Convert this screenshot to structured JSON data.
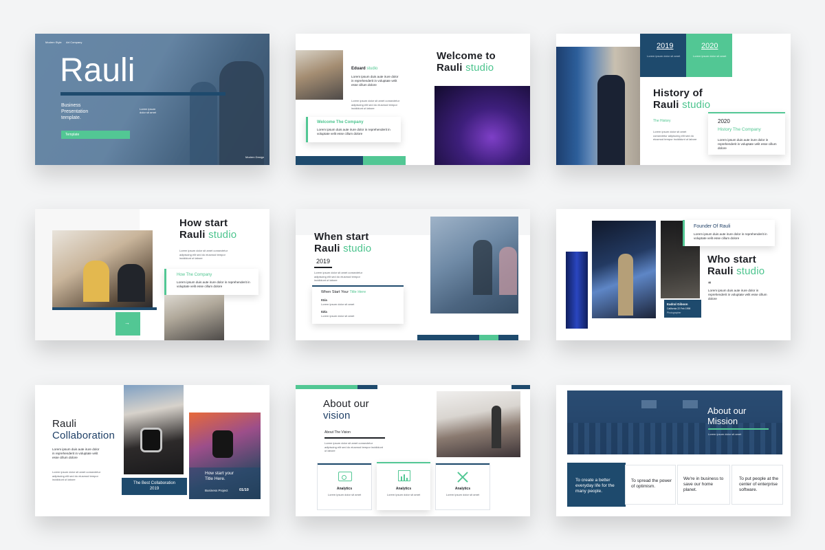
{
  "colors": {
    "navy": "#1e4a6d",
    "green": "#52c794",
    "text": "#1d1f24",
    "background": "#f3f4f5"
  },
  "lorem": {
    "a": "Lorem ipsum dolor sit amet consectetur adipiscing elit sed do eiusmod tempor incididunt ut labore",
    "b": "Lorem ipsum duis aute irure dolor in reprehenderit in voluptate velit esse cillum dolore",
    "c": "Lorem ipsum dolor sit amet"
  },
  "slide1": {
    "tag1": "Modern Style",
    "tag2": "Art Company",
    "title": "Rauli",
    "subtitle_line1": "Business",
    "subtitle_line2": "Presentation",
    "subtitle_line3": "template.",
    "side_note": "Lorem ipsum dolor sit amet",
    "button": "Template",
    "footer": "Modern Design"
  },
  "slide2": {
    "name": "Eduard",
    "name_accent": "studio",
    "title_line1": "Welcome to",
    "title_line2": "Rauli",
    "title_accent": "studio",
    "box_title": "Welcome The Company"
  },
  "slide3": {
    "year1": "2019",
    "year2": "2020",
    "title_line1": "History of",
    "title_line2": "Rauli",
    "title_accent": "studio",
    "label": "The History",
    "card_year": "2020",
    "card_title": "History The Company"
  },
  "slide4": {
    "title_line1": "How start",
    "title_line2": "Rauli",
    "title_accent": "studio",
    "box_title": "How The Company"
  },
  "slide5": {
    "title_line1": "When start",
    "title_line2": "Rauli",
    "title_accent": "studio",
    "year": "2019",
    "card_title": "When Start Your",
    "card_title_accent": "Title Here",
    "item1": "01/a",
    "item2": "02/a"
  },
  "slide6": {
    "founder": "Founder Of Rauli",
    "title_line1": "Who start",
    "title_line2": "Rauli",
    "title_accent": "studio",
    "person": "Eadral Gibson",
    "person_sub": "California 22 Feb 1998",
    "person_role": "Photographer"
  },
  "slide7": {
    "title_line1": "Rauli",
    "title_line2": "Collaboration",
    "box1_line1": "The Best Collaboration",
    "box1_line2": "2019",
    "box2_line1": "How start your",
    "box2_line2": "Title Here.",
    "box2_sub": "Business Project",
    "page": "01/10"
  },
  "slide8": {
    "title_line1": "About our",
    "title_line2": "vision",
    "subtitle": "About The Vision",
    "cards": [
      {
        "icon": "chart-icon",
        "label": "Analytics"
      },
      {
        "icon": "bar-chart-icon",
        "label": "Analytics"
      },
      {
        "icon": "tools-icon",
        "label": "Analytics"
      }
    ]
  },
  "slide9": {
    "title_line1": "About our",
    "title_line2": "Mission",
    "boxes": [
      "To create a better everyday life for the many people.",
      "To spread the power of optimism.",
      "We're in business to save our home planet.",
      "To put people at the center of enterprise software."
    ]
  }
}
